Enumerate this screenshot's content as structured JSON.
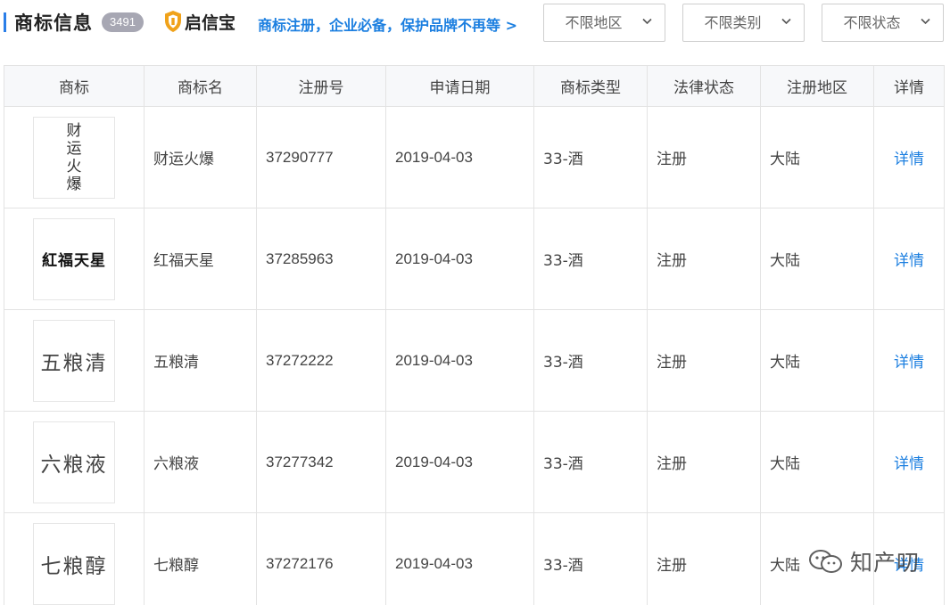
{
  "header": {
    "title": "商标信息",
    "count": "3491",
    "brand": "启信宝",
    "promo": "商标注册，企业必备，保护品牌不再等 >"
  },
  "filters": {
    "region": "不限地区",
    "category": "不限类别",
    "status": "不限状态"
  },
  "table": {
    "columns": [
      "商标",
      "商标名",
      "注册号",
      "申请日期",
      "商标类型",
      "法律状态",
      "注册地区",
      "详情"
    ],
    "rows": [
      {
        "logo": "财运火爆",
        "name": "财运火爆",
        "reg_no": "37290777",
        "date": "2019-04-03",
        "type": "33-酒",
        "status": "注册",
        "region": "大陆",
        "detail": "详情"
      },
      {
        "logo": "紅福天星",
        "name": "红福天星",
        "reg_no": "37285963",
        "date": "2019-04-03",
        "type": "33-酒",
        "status": "注册",
        "region": "大陆",
        "detail": "详情"
      },
      {
        "logo": "五粮清",
        "name": "五粮清",
        "reg_no": "37272222",
        "date": "2019-04-03",
        "type": "33-酒",
        "status": "注册",
        "region": "大陆",
        "detail": "详情"
      },
      {
        "logo": "六粮液",
        "name": "六粮液",
        "reg_no": "37277342",
        "date": "2019-04-03",
        "type": "33-酒",
        "status": "注册",
        "region": "大陆",
        "detail": "详情"
      },
      {
        "logo": "七粮醇",
        "name": "七粮醇",
        "reg_no": "37272176",
        "date": "2019-04-03",
        "type": "33-酒",
        "status": "注册",
        "region": "大陆",
        "detail": "详情"
      }
    ]
  },
  "watermark": "知产叨",
  "colors": {
    "accent": "#2a7ee8",
    "link": "#1c7fe0",
    "badge": "#a7a7b3",
    "brand_shield": "#f0a21a"
  }
}
